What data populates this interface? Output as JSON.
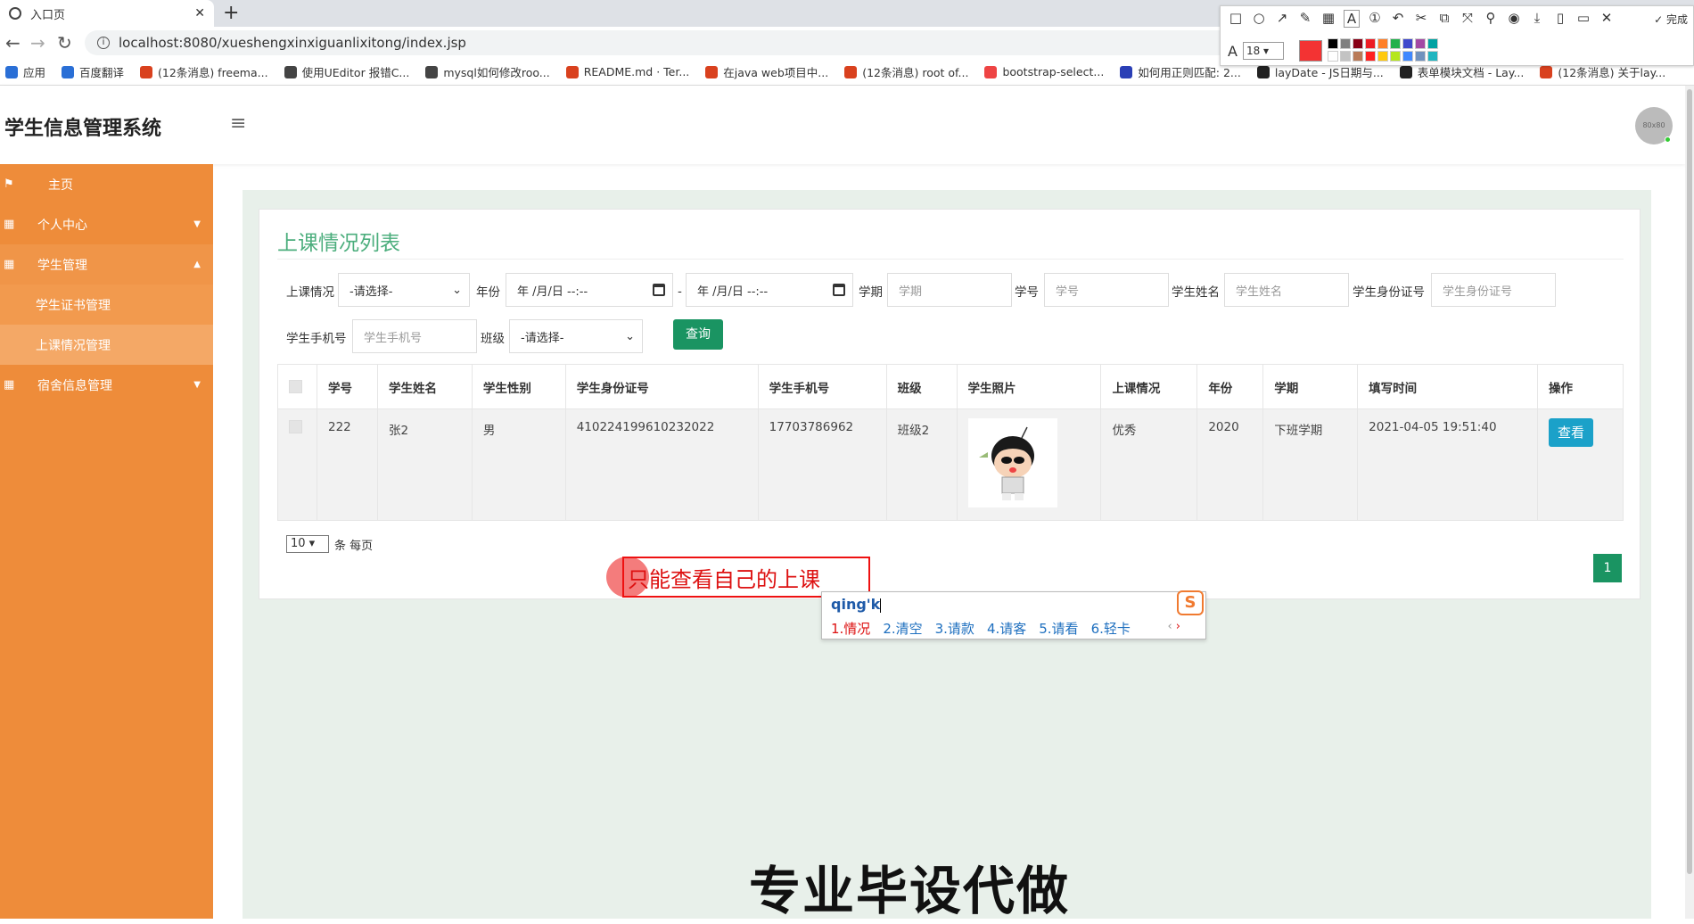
{
  "browser": {
    "tab_title": "入口页",
    "url": "localhost:8080/xueshengxinxiguanlixitong/index.jsp",
    "bookmarks": [
      {
        "label": "应用",
        "color": "#2a6fd6"
      },
      {
        "label": "百度翻译",
        "color": "#2a6fd6"
      },
      {
        "label": "(12条消息) freema...",
        "color": "#d9411e"
      },
      {
        "label": "使用UEditor 报错C...",
        "color": "#444"
      },
      {
        "label": "mysql如何修改roo...",
        "color": "#444"
      },
      {
        "label": "README.md · Ter...",
        "color": "#d9411e"
      },
      {
        "label": "在java web项目中...",
        "color": "#d9411e"
      },
      {
        "label": "(12条消息) root of...",
        "color": "#d9411e"
      },
      {
        "label": "bootstrap-select...",
        "color": "#e44"
      },
      {
        "label": "如何用正则匹配: 2...",
        "color": "#2a3fb6"
      },
      {
        "label": "layDate - JS日期与...",
        "color": "#222"
      },
      {
        "label": "表单模块文档 - Lay...",
        "color": "#222"
      },
      {
        "label": "(12条消息) 关于lay...",
        "color": "#d9411e"
      }
    ]
  },
  "annotator": {
    "done_label": "完成",
    "font_size": "18",
    "current_color": "#f33333",
    "palette": [
      "#000000",
      "#7f7f7f",
      "#880015",
      "#ed1c24",
      "#ff7f27",
      "#22b14c",
      "#3f48cc",
      "#a349a4",
      "#00a2a2",
      "#ffffff",
      "#c3c3c3",
      "#b97a57",
      "#ff2020",
      "#ffc90e",
      "#b5e61d",
      "#3f88ff",
      "#7092be",
      "#1fb5c0"
    ]
  },
  "app": {
    "title": "学生信息管理系统",
    "avatar_text": "80x80"
  },
  "sidebar": {
    "items": [
      {
        "label": "主页",
        "icon": "flag-icon"
      },
      {
        "label": "个人中心",
        "icon": "grid-icon"
      },
      {
        "label": "学生管理",
        "icon": "grid-icon"
      },
      {
        "label": "学生证书管理"
      },
      {
        "label": "上课情况管理"
      },
      {
        "label": "宿舍信息管理",
        "icon": "grid-icon"
      }
    ]
  },
  "panel": {
    "title": "上课情况列表",
    "filters": {
      "status_label": "上课情况",
      "status_value": "-请选择-",
      "year_label": "年份",
      "date_placeholder": "年 /月/日 --:--",
      "date_sep": "-",
      "term_label": "学期",
      "term_placeholder": "学期",
      "sid_label": "学号",
      "sid_placeholder": "学号",
      "name_label": "学生姓名",
      "name_placeholder": "学生姓名",
      "idcard_label": "学生身份证号",
      "idcard_placeholder": "学生身份证号",
      "phone_label": "学生手机号",
      "phone_placeholder": "学生手机号",
      "class_label": "班级",
      "class_value": "-请选择-",
      "query_label": "查询"
    },
    "table": {
      "headers": [
        "学号",
        "学生姓名",
        "学生性别",
        "学生身份证号",
        "学生手机号",
        "班级",
        "学生照片",
        "上课情况",
        "年份",
        "学期",
        "填写时间",
        "操作"
      ],
      "rows": [
        {
          "sid": "222",
          "name": "张2",
          "gender": "男",
          "idcard": "410224199610232022",
          "phone": "17703786962",
          "class": "班级2",
          "status": "优秀",
          "year": "2020",
          "term": "下班学期",
          "time": "2021-04-05 19:51:40",
          "action": "查看"
        }
      ]
    },
    "pager": {
      "page_size": "10",
      "page_size_label": "条 每页",
      "current_page": "1"
    }
  },
  "overlay": {
    "annotation_text": "只能查看自己的上课",
    "ime_input": "qing'k",
    "ime_candidates": [
      "1.情况",
      "2.清空",
      "3.请款",
      "4.请客",
      "5.请看",
      "6.轻卡"
    ],
    "ime_logo": "S",
    "watermark": "专业毕设代做"
  }
}
